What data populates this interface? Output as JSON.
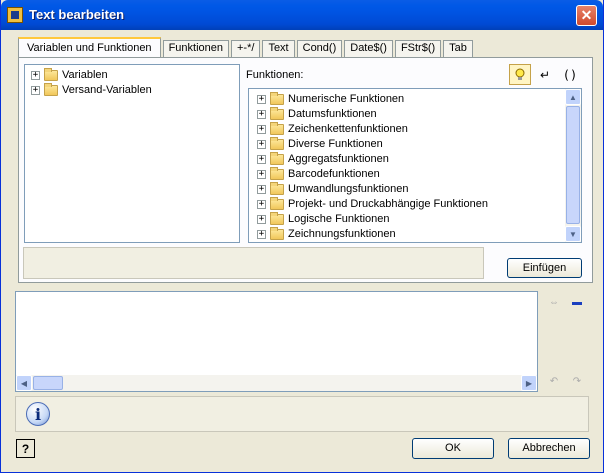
{
  "window": {
    "title": "Text bearbeiten"
  },
  "tabs": [
    {
      "label": "Variablen und Funktionen"
    },
    {
      "label": "Funktionen"
    },
    {
      "label": "+-*/"
    },
    {
      "label": "Text"
    },
    {
      "label": "Cond()"
    },
    {
      "label": "Date$()"
    },
    {
      "label": "FStr$()"
    },
    {
      "label": "Tab"
    }
  ],
  "variables_tree": [
    {
      "label": "Variablen"
    },
    {
      "label": "Versand-Variablen"
    }
  ],
  "functions_label": "Funktionen:",
  "functions_tree": [
    {
      "label": "Numerische Funktionen"
    },
    {
      "label": "Datumsfunktionen"
    },
    {
      "label": "Zeichenkettenfunktionen"
    },
    {
      "label": "Diverse Funktionen"
    },
    {
      "label": "Aggregatsfunktionen"
    },
    {
      "label": "Barcodefunktionen"
    },
    {
      "label": "Umwandlungsfunktionen"
    },
    {
      "label": "Projekt- und Druckabhängige Funktionen"
    },
    {
      "label": "Logische Funktionen"
    },
    {
      "label": "Zeichnungsfunktionen"
    }
  ],
  "toolbar": {
    "paren_glyph": "()",
    "return_glyph": "↵"
  },
  "insert_button": "Einfügen",
  "editor": {
    "text": ""
  },
  "footer": {
    "ok": "OK",
    "cancel": "Abbrechen",
    "help_glyph": "?"
  }
}
